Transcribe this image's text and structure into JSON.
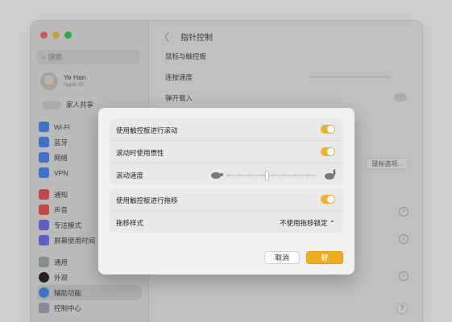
{
  "window": {
    "traffic_colors": [
      "#ff5f57",
      "#febc2e",
      "#28c840"
    ],
    "search_placeholder": "搜索"
  },
  "sidebar": {
    "user_name": "Ye Han",
    "user_sub": "Apple ID",
    "family": "家人共享",
    "groups": [
      [
        {
          "label": "Wi-Fi",
          "color": "#3b82f6"
        },
        {
          "label": "蓝牙",
          "color": "#3b82f6"
        },
        {
          "label": "网络",
          "color": "#3b82f6"
        },
        {
          "label": "VPN",
          "color": "#3b82f6"
        }
      ],
      [
        {
          "label": "通知",
          "color": "#ef4444"
        },
        {
          "label": "声音",
          "color": "#ef4444"
        },
        {
          "label": "专注模式",
          "color": "#6366f1"
        },
        {
          "label": "屏幕使用时间",
          "color": "#6366f1"
        }
      ],
      [
        {
          "label": "通用",
          "color": "#9ca3af"
        },
        {
          "label": "外观",
          "color": "#111111"
        },
        {
          "label": "辅助功能",
          "color": "#3b82f6"
        },
        {
          "label": "控制中心",
          "color": "#9ca3af"
        }
      ]
    ]
  },
  "content": {
    "back": "〈",
    "title": "指针控制",
    "section": "鼠标与触控板",
    "rows": {
      "double_click": "连按速度",
      "spring": "弹开载入",
      "pointer_options": "鼠标选项..."
    }
  },
  "dialog": {
    "rows": [
      {
        "label": "使用触控板进行滚动",
        "toggle": true
      },
      {
        "label": "滚动时使用惯性",
        "toggle": true
      },
      {
        "label": "滚动速度",
        "slider": 0.45
      }
    ],
    "rows2": [
      {
        "label": "使用触控板进行拖移",
        "toggle": true
      },
      {
        "label": "拖移样式",
        "value": "不使用拖移锁定"
      }
    ],
    "cancel": "取消",
    "ok": "好",
    "accent": "#f2ad1c"
  }
}
